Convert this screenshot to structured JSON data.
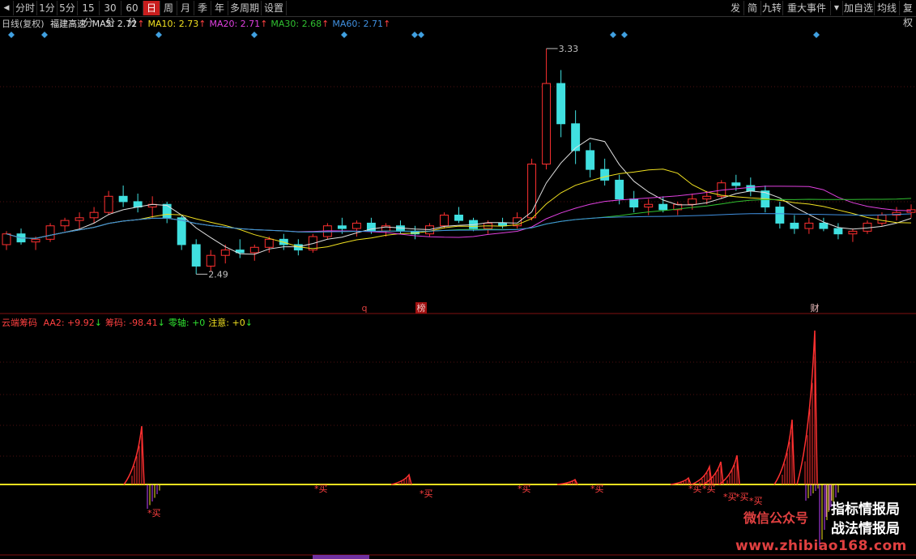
{
  "toolbar": {
    "left_tabs": [
      "分时",
      "1分",
      "5分",
      "15分",
      "30分",
      "60分",
      "日",
      "周",
      "月",
      "季",
      "年",
      "多周期",
      "设置"
    ],
    "active_tab": "日",
    "right_tabs": [
      "发",
      "简",
      "九转",
      "重大事件",
      "加自选",
      "均线",
      "复权"
    ]
  },
  "header": {
    "period": "日线(复权)",
    "stock_name": "福建高速",
    "ma": [
      {
        "label": "MA5: 2.72",
        "arrow": "↑",
        "color": "#e0e0e0"
      },
      {
        "label": "MA10: 2.73",
        "arrow": "↑",
        "color": "#f0e020"
      },
      {
        "label": "MA20: 2.71",
        "arrow": "↑",
        "color": "#e040e0"
      },
      {
        "label": "MA30: 2.68",
        "arrow": "↑",
        "color": "#30c030"
      },
      {
        "label": "MA60: 2.71",
        "arrow": "↑",
        "color": "#4090e0"
      }
    ]
  },
  "price_chart": {
    "high_label": "3.33",
    "low_label": "2.49",
    "event_markers": [
      "q",
      "榜",
      "财"
    ]
  },
  "indicator": {
    "name": "云端筹码",
    "items": [
      {
        "label": "AA2: +9.92",
        "arrow": "↓",
        "color": "#ff4040"
      },
      {
        "label": "筹码: -98.41",
        "arrow": "↓",
        "color": "#ff4040"
      },
      {
        "label": "零轴: +0",
        "arrow": "",
        "color": "#30e030"
      },
      {
        "label": "注意: +0",
        "arrow": "↓",
        "color": "#f0e020"
      }
    ],
    "buy_label": "*买"
  },
  "watermark": {
    "line1": "指标情报局",
    "line2": "微信公众号",
    "line3": "战法情报局",
    "url": "www.zhibiao168.com"
  },
  "colors": {
    "up": "#ff3030",
    "down": "#40e0e0",
    "active_tab": "#c81e1e",
    "zero_line": "#f0e020"
  },
  "chart_data": {
    "type": "candlestick",
    "price_range": [
      2.49,
      3.33
    ],
    "candles": [
      [
        2.6,
        2.65,
        2.58,
        2.64
      ],
      [
        2.64,
        2.66,
        2.6,
        2.61
      ],
      [
        2.61,
        2.63,
        2.58,
        2.62
      ],
      [
        2.62,
        2.68,
        2.61,
        2.67
      ],
      [
        2.67,
        2.7,
        2.65,
        2.69
      ],
      [
        2.69,
        2.72,
        2.66,
        2.7
      ],
      [
        2.7,
        2.74,
        2.68,
        2.72
      ],
      [
        2.72,
        2.8,
        2.71,
        2.78
      ],
      [
        2.78,
        2.82,
        2.74,
        2.76
      ],
      [
        2.76,
        2.79,
        2.72,
        2.74
      ],
      [
        2.74,
        2.78,
        2.7,
        2.75
      ],
      [
        2.75,
        2.76,
        2.68,
        2.7
      ],
      [
        2.7,
        2.71,
        2.58,
        2.6
      ],
      [
        2.6,
        2.62,
        2.49,
        2.52
      ],
      [
        2.52,
        2.58,
        2.5,
        2.56
      ],
      [
        2.56,
        2.6,
        2.53,
        2.58
      ],
      [
        2.58,
        2.62,
        2.55,
        2.57
      ],
      [
        2.57,
        2.6,
        2.54,
        2.59
      ],
      [
        2.59,
        2.63,
        2.57,
        2.62
      ],
      [
        2.62,
        2.64,
        2.58,
        2.6
      ],
      [
        2.6,
        2.62,
        2.56,
        2.58
      ],
      [
        2.58,
        2.64,
        2.57,
        2.63
      ],
      [
        2.63,
        2.68,
        2.62,
        2.67
      ],
      [
        2.67,
        2.7,
        2.64,
        2.66
      ],
      [
        2.66,
        2.69,
        2.63,
        2.68
      ],
      [
        2.68,
        2.7,
        2.64,
        2.65
      ],
      [
        2.65,
        2.68,
        2.63,
        2.67
      ],
      [
        2.67,
        2.69,
        2.64,
        2.65
      ],
      [
        2.65,
        2.67,
        2.62,
        2.64
      ],
      [
        2.64,
        2.68,
        2.63,
        2.67
      ],
      [
        2.67,
        2.72,
        2.66,
        2.71
      ],
      [
        2.71,
        2.74,
        2.68,
        2.69
      ],
      [
        2.69,
        2.7,
        2.65,
        2.66
      ],
      [
        2.66,
        2.69,
        2.64,
        2.68
      ],
      [
        2.68,
        2.7,
        2.66,
        2.67
      ],
      [
        2.67,
        2.72,
        2.66,
        2.7
      ],
      [
        2.7,
        2.92,
        2.69,
        2.9
      ],
      [
        2.9,
        3.33,
        2.88,
        3.2
      ],
      [
        3.2,
        3.25,
        3.0,
        3.05
      ],
      [
        3.05,
        3.1,
        2.9,
        2.95
      ],
      [
        2.95,
        2.98,
        2.85,
        2.88
      ],
      [
        2.88,
        2.92,
        2.82,
        2.84
      ],
      [
        2.84,
        2.86,
        2.75,
        2.77
      ],
      [
        2.77,
        2.8,
        2.72,
        2.74
      ],
      [
        2.74,
        2.77,
        2.71,
        2.75
      ],
      [
        2.75,
        2.78,
        2.72,
        2.73
      ],
      [
        2.73,
        2.76,
        2.71,
        2.75
      ],
      [
        2.75,
        2.79,
        2.73,
        2.77
      ],
      [
        2.77,
        2.8,
        2.75,
        2.78
      ],
      [
        2.78,
        2.84,
        2.77,
        2.83
      ],
      [
        2.83,
        2.86,
        2.8,
        2.82
      ],
      [
        2.82,
        2.85,
        2.78,
        2.8
      ],
      [
        2.8,
        2.82,
        2.72,
        2.74
      ],
      [
        2.74,
        2.76,
        2.66,
        2.68
      ],
      [
        2.68,
        2.71,
        2.64,
        2.66
      ],
      [
        2.66,
        2.7,
        2.64,
        2.68
      ],
      [
        2.68,
        2.7,
        2.65,
        2.66
      ],
      [
        2.66,
        2.68,
        2.62,
        2.64
      ],
      [
        2.64,
        2.66,
        2.61,
        2.65
      ],
      [
        2.65,
        2.69,
        2.64,
        2.68
      ],
      [
        2.68,
        2.72,
        2.67,
        2.71
      ],
      [
        2.71,
        2.74,
        2.69,
        2.72
      ],
      [
        2.72,
        2.75,
        2.7,
        2.73
      ]
    ]
  }
}
